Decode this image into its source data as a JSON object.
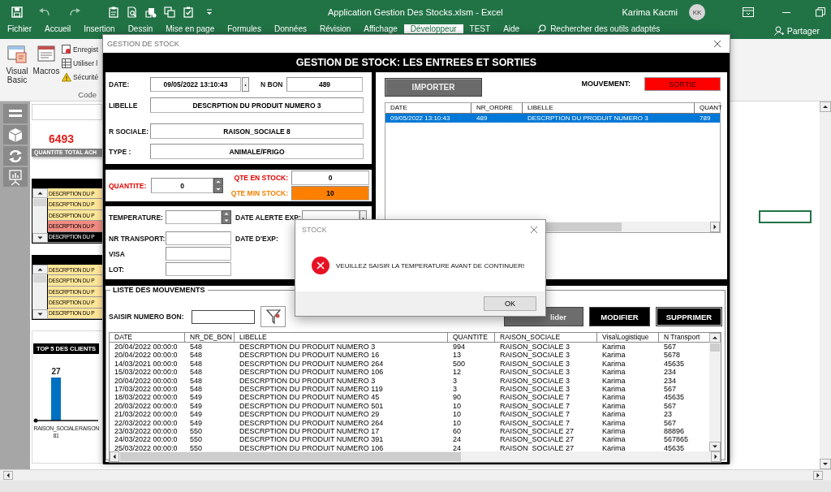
{
  "excel": {
    "title": "Application Gestion Des Stocks.xlsm - Excel",
    "user": "Karima Kacmi",
    "avatar": "KK",
    "tabs": [
      {
        "label": "Fichier",
        "selected": false
      },
      {
        "label": "Accueil",
        "selected": false
      },
      {
        "label": "Insertion",
        "selected": false
      },
      {
        "label": "Dessin",
        "selected": false
      },
      {
        "label": "Mise en page",
        "selected": false
      },
      {
        "label": "Formules",
        "selected": false
      },
      {
        "label": "Données",
        "selected": false
      },
      {
        "label": "Révision",
        "selected": false
      },
      {
        "label": "Affichage",
        "selected": false
      },
      {
        "label": "Développeur",
        "selected": true
      },
      {
        "label": "TEST",
        "selected": false
      },
      {
        "label": "Aide",
        "selected": false
      }
    ],
    "search": "Rechercher des outils adaptés",
    "share": "Partager",
    "ribbon": {
      "large": [
        "Visual Basic",
        "Macros"
      ],
      "small": [
        "Enregist",
        "Utiliser l",
        "Sécurité"
      ],
      "group": "Code"
    },
    "sheet": {
      "total": "6493",
      "total_label": "QUANTITE TOTAL ACH",
      "lists": [
        {
          "rows": [
            {
              "text": "DESCRPTION DU P",
              "color": "#ffe699"
            },
            {
              "text": "DESCRPTION DU P",
              "color": "#ffe699"
            },
            {
              "text": "DESCRPTION DU P",
              "color": "#ffe699"
            },
            {
              "text": "DESCRPTION DU P",
              "color": "#f28b82"
            },
            {
              "text": "DESCRPTION DU P",
              "color": "#000000"
            }
          ]
        },
        {
          "rows": [
            {
              "text": "DESCRPTION DU P",
              "color": "#ffe699"
            },
            {
              "text": "DESCRPTION DU P",
              "color": "#ffe699"
            },
            {
              "text": "DESCRPTION DU P",
              "color": "#ffe699"
            },
            {
              "text": "DESCRPTION DU P",
              "color": "#ffe699"
            },
            {
              "text": "DESCRPTION DU P",
              "color": "#ffe699"
            }
          ]
        }
      ],
      "chart": {
        "title": "TOP 5 DES CLIENTS",
        "value_label": "27",
        "categories": [
          "RAISON_SOCIALE 81",
          "RAISON"
        ]
      }
    }
  },
  "form": {
    "title": "GESTION DE STOCK",
    "header": "GESTION DE STOCK: LES ENTREES ET SORTIES",
    "date_label": "DATE:",
    "date": "09/05/2022 13:10:43",
    "nbon_label": "N BON",
    "nbon": "489",
    "libelle_label": "LIBELLE",
    "libelle": "DESCRPTION DU PRODUIT NUMERO 3",
    "rsociale_label": "R SOCIALE:",
    "rsociale": "RAISON_SOCIALE 8",
    "type_label": "TYPE :",
    "type": "ANIMALE/FRIGO",
    "quantite_label": "QUANTITE:",
    "quantite": "0",
    "qte_stock_label": "QTE EN STOCK:",
    "qte_stock": "0",
    "qte_min_label": "QTE MIN STOCK:",
    "qte_min": "10",
    "temperature_label": "TEMPERATURE:",
    "date_alerte_label": "DATE ALERTE EXP:",
    "nr_transport_label": "NR TRANSPORT:",
    "date_exp_label": "DATE D'EXP:",
    "visa_label": "VISA",
    "lot_label": "LOT:",
    "import_button": "IMPORTER",
    "mouvement_label": "MOUVEMENT:",
    "mouvement": "SORTIE",
    "entry_list": {
      "columns": [
        "DATE",
        "NR_ORDRE",
        "LIBELLE",
        "QUANT"
      ],
      "rows": [
        {
          "cells": [
            "09/05/2022 13:10:43",
            "489",
            "DESCRPTION DU PRODUIT NUMERO 3",
            "789"
          ],
          "selected": true
        }
      ]
    },
    "movements_title": "LISTE DES MOUVEMENTS",
    "search_label": "SAISIR NUMERO BON:",
    "buttons": [
      {
        "label": "lider",
        "disabled": true
      },
      {
        "label": "MODIFIER",
        "disabled": false
      },
      {
        "label": "SUPPRIMER",
        "disabled": false
      }
    ],
    "table": {
      "columns": [
        "DATE",
        "NR_DE_BON",
        "LIBELLE",
        "QUANTITE",
        "RAISON_SOCIALE",
        "Visa\\Logistique",
        "N Transport"
      ],
      "rows": [
        [
          "20/04/2022 00:00:0",
          "548",
          "DESCRPTION DU PRODUIT NUMERO 3",
          "994",
          "RAISON_SOCIALE 3",
          "Karima",
          "567"
        ],
        [
          "20/04/2022 00:00:0",
          "548",
          "DESCRPTION DU PRODUIT NUMERO 16",
          "13",
          "RAISON_SOCIALE 3",
          "Karima",
          "5678"
        ],
        [
          "14/03/2021 00:00:0",
          "548",
          "DESCRPTION DU PRODUIT NUMERO 264",
          "500",
          "RAISON_SOCIALE 3",
          "Karima",
          "45635"
        ],
        [
          "15/03/2022 00:00:0",
          "548",
          "DESCRPTION DU PRODUIT NUMERO 106",
          "12",
          "RAISON_SOCIALE 3",
          "Karima",
          "234"
        ],
        [
          "20/04/2022 00:00:0",
          "548",
          "DESCRPTION DU PRODUIT NUMERO 3",
          "3",
          "RAISON_SOCIALE 3",
          "Karima",
          "234"
        ],
        [
          "17/03/2022 00:00:0",
          "548",
          "DESCRPTION DU PRODUIT NUMERO 119",
          "3",
          "RAISON_SOCIALE 3",
          "Karima",
          "567"
        ],
        [
          "18/03/2022 00:00:0",
          "549",
          "DESCRPTION DU PRODUIT NUMERO 45",
          "90",
          "RAISON_SOCIALE 7",
          "Karima",
          "45635"
        ],
        [
          "20/03/2022 00:00:0",
          "549",
          "DESCRPTION DU PRODUIT NUMERO 501",
          "10",
          "RAISON_SOCIALE 7",
          "Karima",
          "567"
        ],
        [
          "21/03/2022 00:00:0",
          "549",
          "DESCRPTION DU PRODUIT NUMERO 29",
          "10",
          "RAISON_SOCIALE 7",
          "Karima",
          "23"
        ],
        [
          "22/03/2022 00:00:0",
          "549",
          "DESCRPTION DU PRODUIT NUMERO 264",
          "10",
          "RAISON_SOCIALE 7",
          "Karima",
          "567"
        ],
        [
          "23/03/2022 00:00:0",
          "550",
          "DESCRPTION DU PRODUIT NUMERO 17",
          "60",
          "RAISON_SOCIALE 27",
          "Karima",
          "88896"
        ],
        [
          "24/03/2022 00:00:0",
          "550",
          "DESCRPTION DU PRODUIT NUMERO 391",
          "24",
          "RAISON_SOCIALE 27",
          "Karima",
          "567865"
        ],
        [
          "25/03/2022 00:00:0",
          "550",
          "DESCRPTION DU PRODUIT NUMERO 106",
          "24",
          "RAISON_SOCIALE 27",
          "Karima",
          "45635"
        ]
      ]
    }
  },
  "dialog": {
    "title": "STOCK",
    "message": "VEUILLEZ SAISIR LA TEMPERATURE AVANT DE CONTINUER!",
    "ok": "OK"
  }
}
